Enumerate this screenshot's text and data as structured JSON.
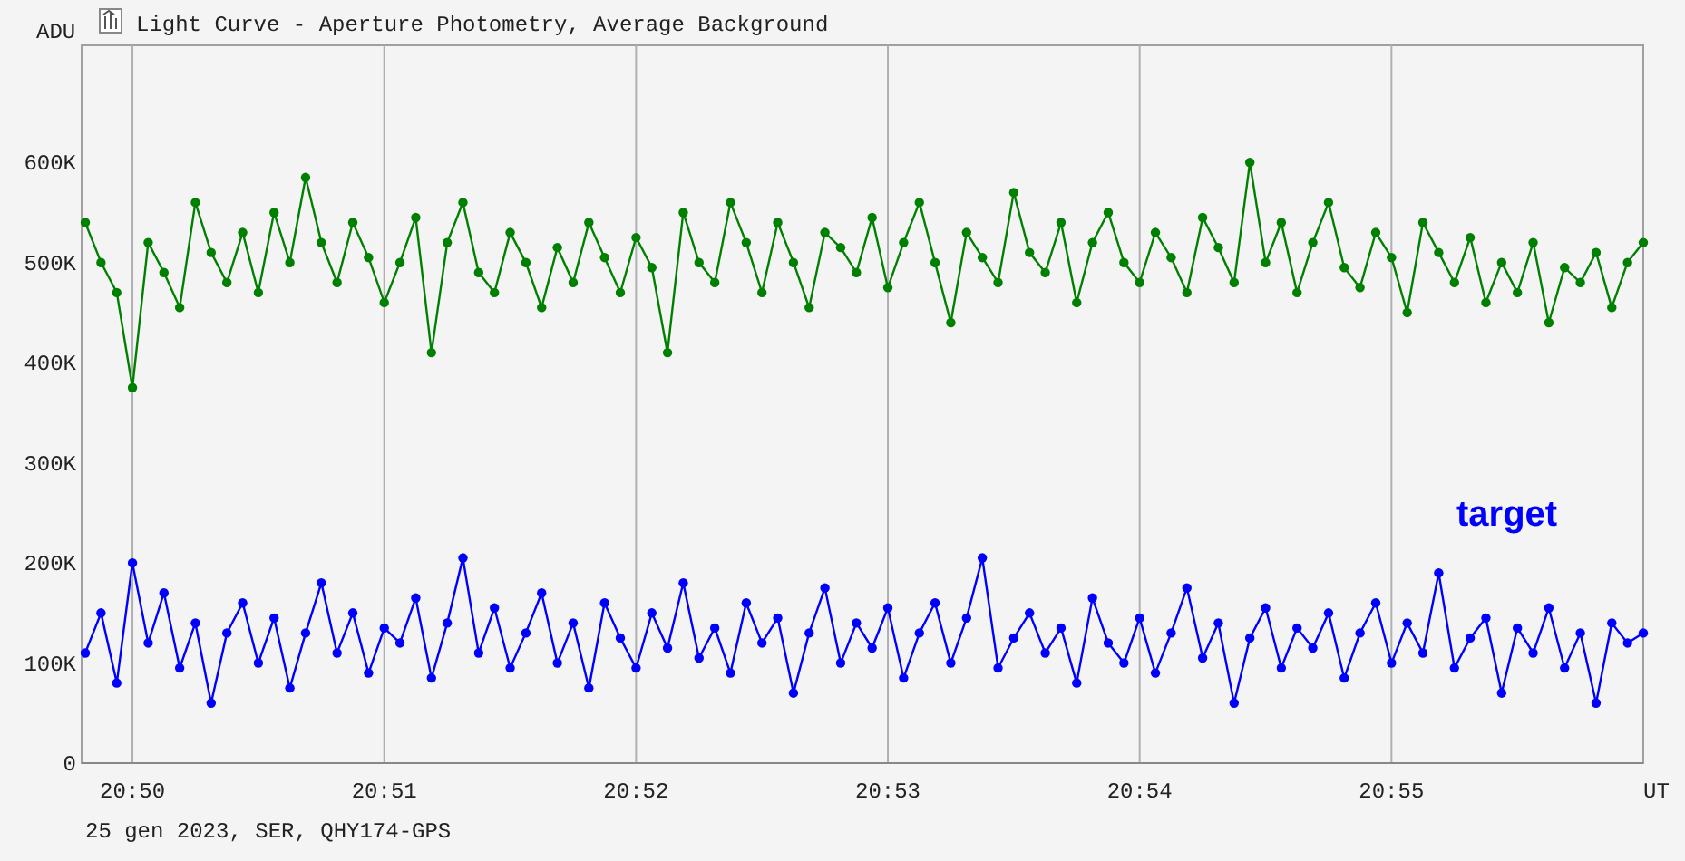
{
  "window": {
    "title": "Light Curve - Aperture Photometry, Average Background"
  },
  "chart": {
    "chart_data": {
      "type": "line",
      "grid": true,
      "ylabel": "ADU",
      "xlabel": "UT",
      "ylim": [
        0,
        717
      ],
      "categories": [
        null,
        null,
        null,
        "20:50",
        null,
        null,
        null,
        null,
        null,
        null,
        null,
        null,
        null,
        null,
        null,
        null,
        null,
        null,
        null,
        "20:51",
        null,
        null,
        null,
        null,
        null,
        null,
        null,
        null,
        null,
        null,
        null,
        null,
        null,
        null,
        null,
        "20:52",
        null,
        null,
        null,
        null,
        null,
        null,
        null,
        null,
        null,
        null,
        null,
        null,
        null,
        null,
        null,
        "20:53",
        null,
        null,
        null,
        null,
        null,
        null,
        null,
        null,
        null,
        null,
        null,
        null,
        null,
        null,
        null,
        "20:54",
        null,
        null,
        null,
        null,
        null,
        null,
        null,
        null,
        null,
        null,
        null,
        null,
        null,
        null,
        null,
        "20:55",
        null,
        null,
        null,
        null,
        null,
        null,
        null,
        null,
        null,
        null,
        null,
        null,
        null,
        null,
        null,
        null
      ],
      "yticks": [
        {
          "value": 0,
          "label": "0"
        },
        {
          "value": 100,
          "label": "100K"
        },
        {
          "value": 200,
          "label": "200K"
        },
        {
          "value": 300,
          "label": "300K"
        },
        {
          "value": 400,
          "label": "400K"
        },
        {
          "value": 500,
          "label": "500K"
        },
        {
          "value": 600,
          "label": "600K"
        }
      ],
      "series": [
        {
          "color": "#008000",
          "marker": "circle",
          "values": [
            540,
            500,
            470,
            375,
            520,
            490,
            455,
            560,
            510,
            480,
            530,
            470,
            550,
            500,
            585,
            520,
            480,
            540,
            505,
            460,
            500,
            545,
            410,
            520,
            560,
            490,
            470,
            530,
            500,
            455,
            515,
            480,
            540,
            505,
            470,
            525,
            495,
            410,
            550,
            500,
            480,
            560,
            520,
            470,
            540,
            500,
            455,
            530,
            515,
            490,
            545,
            475,
            520,
            560,
            500,
            440,
            530,
            505,
            480,
            570,
            510,
            490,
            540,
            460,
            520,
            550,
            500,
            480,
            530,
            505,
            470,
            545,
            515,
            480,
            600,
            500,
            540,
            470,
            520,
            560,
            495,
            475,
            530,
            505,
            450,
            540,
            510,
            480,
            525,
            460,
            500,
            470,
            520,
            440,
            495,
            480,
            510,
            455,
            500,
            520
          ]
        },
        {
          "name": "target",
          "color": "#0000ff",
          "marker": "circle",
          "values": [
            110,
            150,
            80,
            200,
            120,
            170,
            95,
            140,
            60,
            130,
            160,
            100,
            145,
            75,
            130,
            180,
            110,
            150,
            90,
            135,
            120,
            165,
            85,
            140,
            205,
            110,
            155,
            95,
            130,
            170,
            100,
            140,
            75,
            160,
            125,
            95,
            150,
            115,
            180,
            105,
            135,
            90,
            160,
            120,
            145,
            70,
            130,
            175,
            100,
            140,
            115,
            155,
            85,
            130,
            160,
            100,
            145,
            205,
            95,
            125,
            150,
            110,
            135,
            80,
            165,
            120,
            100,
            145,
            90,
            130,
            175,
            105,
            140,
            60,
            125,
            155,
            95,
            135,
            115,
            150,
            85,
            130,
            160,
            100,
            140,
            110,
            190,
            95,
            125,
            145,
            70,
            135,
            110,
            155,
            95,
            130,
            60,
            140,
            120,
            130
          ]
        }
      ]
    }
  },
  "footer": "25 gen 2023, SER, QHY174-GPS"
}
